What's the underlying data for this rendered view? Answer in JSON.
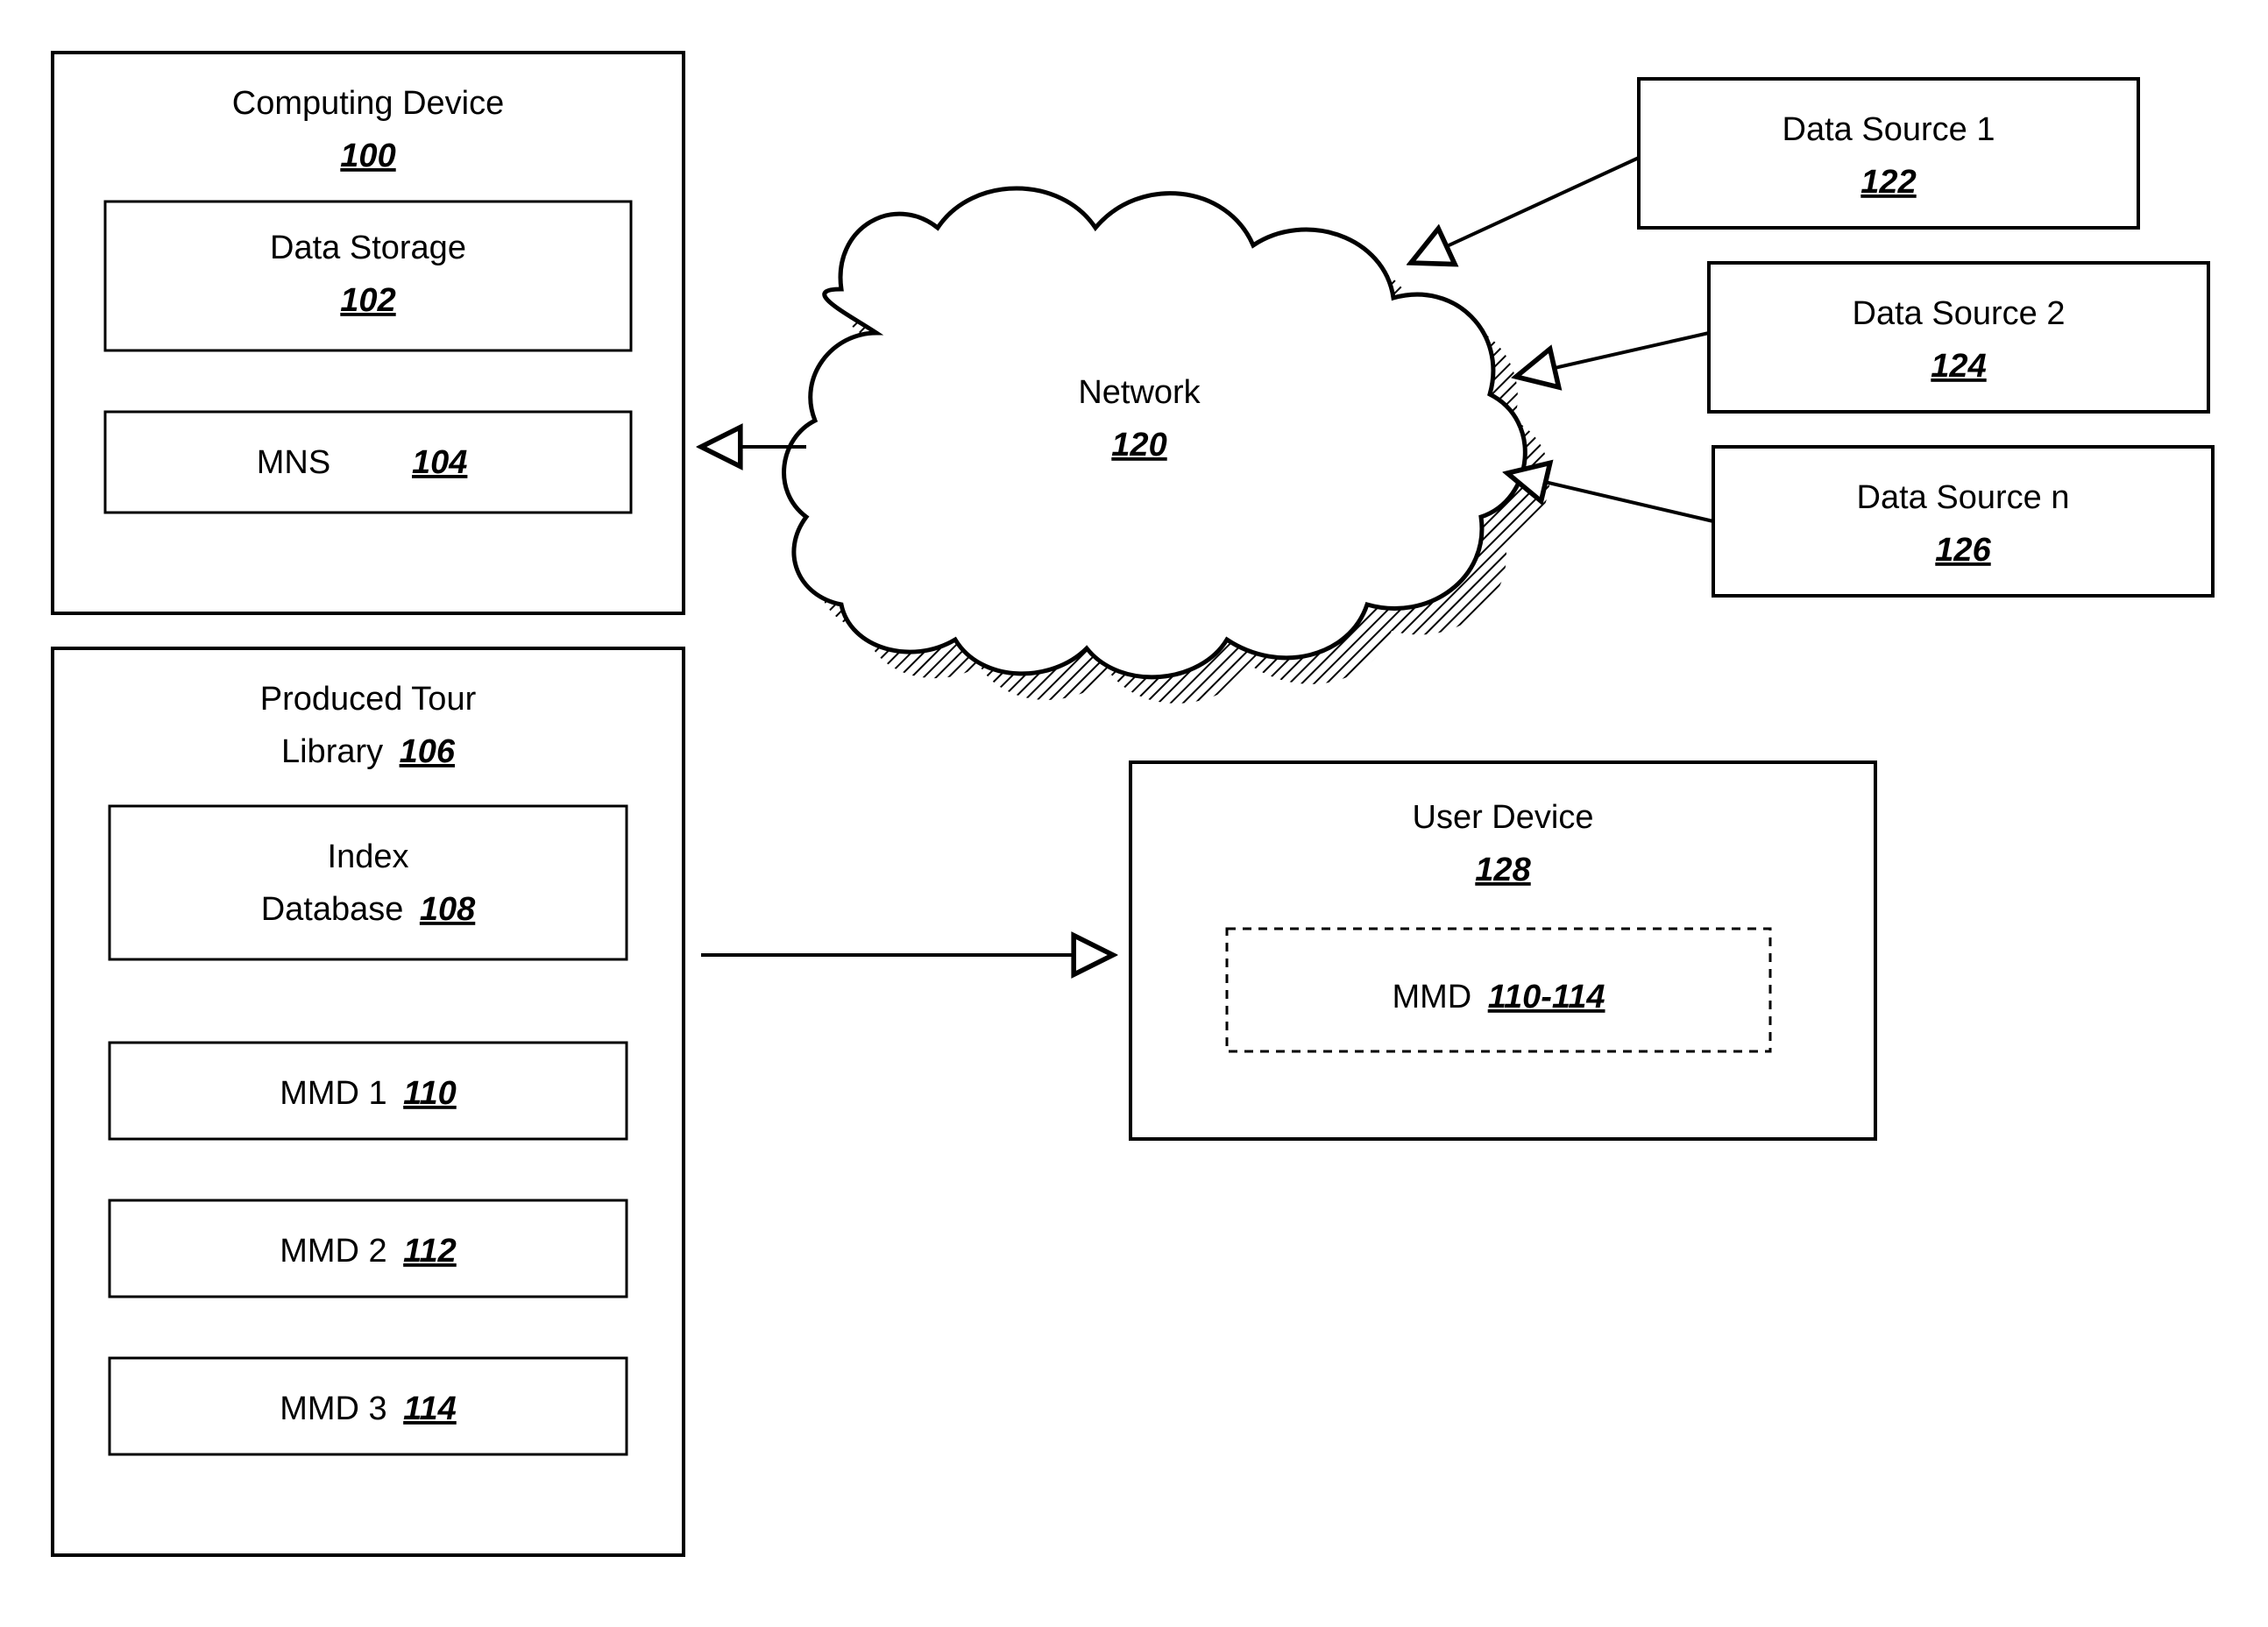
{
  "computing_device": {
    "title": "Computing Device",
    "ref": "100"
  },
  "data_storage": {
    "title": "Data Storage",
    "ref": "102"
  },
  "mns": {
    "title": "MNS",
    "ref": "104"
  },
  "library": {
    "title_l1": "Produced Tour",
    "title_l2": "Library",
    "ref": "106"
  },
  "index_db": {
    "title_l1": "Index",
    "title_l2": "Database",
    "ref": "108"
  },
  "mmd1": {
    "title": "MMD 1",
    "ref": "110"
  },
  "mmd2": {
    "title": "MMD 2",
    "ref": "112"
  },
  "mmd3": {
    "title": "MMD 3",
    "ref": "114"
  },
  "network": {
    "title": "Network",
    "ref": "120"
  },
  "ds1": {
    "title": "Data Source 1",
    "ref": "122"
  },
  "ds2": {
    "title": "Data Source 2",
    "ref": "124"
  },
  "dsn": {
    "title": "Data Source n",
    "ref": "126"
  },
  "user_device": {
    "title": "User Device",
    "ref": "128"
  },
  "user_mmd": {
    "title": "MMD",
    "ref": "110-114"
  }
}
